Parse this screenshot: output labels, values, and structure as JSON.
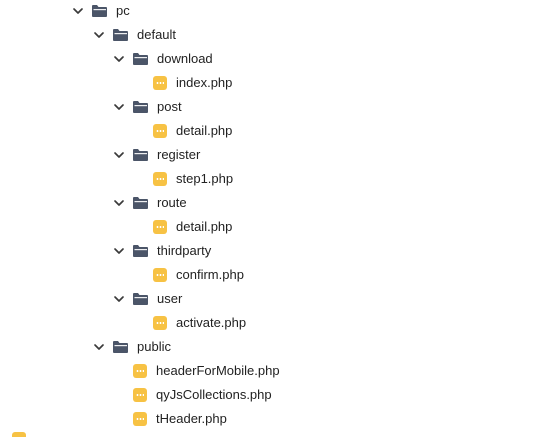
{
  "tree": {
    "pc": "pc",
    "default": "default",
    "download": "download",
    "download_index": "index.php",
    "post": "post",
    "post_detail": "detail.php",
    "register": "register",
    "register_step1": "step1.php",
    "route": "route",
    "route_detail": "detail.php",
    "thirdparty": "thirdparty",
    "thirdparty_confirm": "confirm.php",
    "user": "user",
    "user_activate": "activate.php",
    "public": "public",
    "public_headerForMobile": "headerForMobile.php",
    "public_qyJsCollections": "qyJsCollections.php",
    "public_tHeader": "tHeader.php"
  },
  "icons": {
    "folder": "folder-open-icon",
    "file": "php-file-icon",
    "chevron": "chevron-down-icon"
  },
  "colors": {
    "folder": "#4b5568",
    "file": "#f7c244",
    "chevron": "#3a3a3a"
  }
}
